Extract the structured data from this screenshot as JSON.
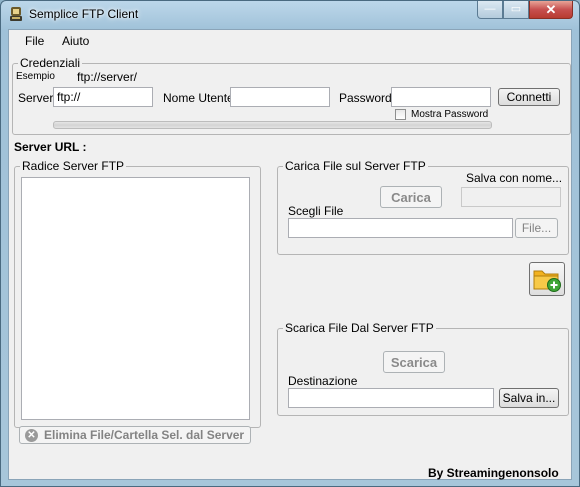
{
  "window": {
    "title": "Semplice FTP Client",
    "minimize_glyph": "—",
    "maximize_glyph": "▭",
    "close_glyph": "✕"
  },
  "menu": {
    "items": [
      "File",
      "Aiuto"
    ]
  },
  "credentials": {
    "legend": "Credenziali",
    "example_label": "Esempio",
    "example_value": "ftp://server/",
    "server_label": "Server",
    "server_value": "ftp://",
    "username_label": "Nome Utente",
    "username_value": "",
    "password_label": "Password",
    "password_value": "",
    "connect_label": "Connetti",
    "show_password_label": "Mostra Password",
    "show_password_checked": false
  },
  "server_url_label": "Server URL :",
  "root": {
    "legend": "Radice Server FTP"
  },
  "upload": {
    "legend": "Carica File sul Server FTP",
    "save_as_label": "Salva con nome...",
    "save_as_value": "",
    "upload_button": "Carica",
    "choose_file_label": "Scegli File",
    "file_value": "",
    "browse_button": "File..."
  },
  "download": {
    "legend": "Scarica File Dal Server FTP",
    "download_button": "Scarica",
    "destination_label": "Destinazione",
    "destination_value": "",
    "save_in_button": "Salva in..."
  },
  "delete_button": "Elimina File/Cartella Sel. dal Server",
  "credits": "By Streamingenonsolo",
  "icons": {
    "app": "ftp-app-icon",
    "new_folder": "folder-add-icon",
    "delete": "delete-x-icon"
  },
  "colors": {
    "title_bar": "#a7c6da",
    "close_button": "#c75050",
    "folder_yellow": "#f2b21f",
    "add_green": "#3fa535"
  }
}
